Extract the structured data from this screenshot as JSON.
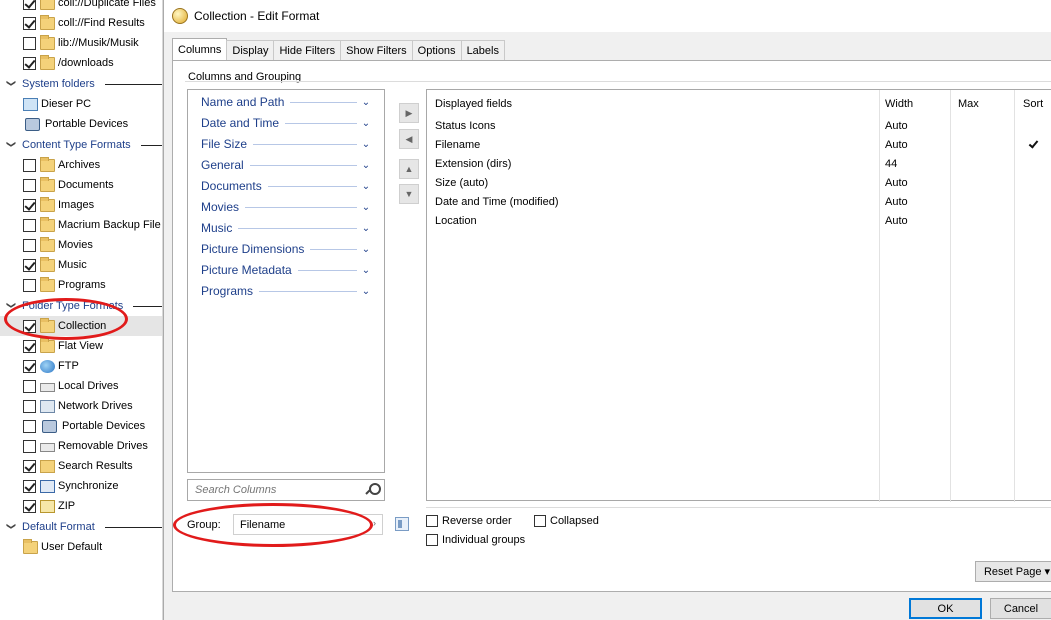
{
  "tree": {
    "top_items": [
      {
        "label": "coll://Duplicate Files",
        "checked": true,
        "icon": "folder-icon"
      },
      {
        "label": "coll://Find Results",
        "checked": true,
        "icon": "folder-icon"
      },
      {
        "label": "lib://Musik/Musik",
        "checked": false,
        "icon": "folder-icon"
      },
      {
        "label": "/downloads",
        "checked": true,
        "icon": "folder-info-icon"
      }
    ],
    "system_folders": {
      "header": "System folders",
      "items": [
        {
          "label": "Dieser PC",
          "icon": "computer-icon"
        },
        {
          "label": "Portable Devices",
          "icon": "portable-device-icon"
        }
      ]
    },
    "content_types": {
      "header": "Content Type Formats",
      "items": [
        {
          "label": "Archives",
          "checked": false,
          "icon": "folder-icon"
        },
        {
          "label": "Documents",
          "checked": false,
          "icon": "folder-icon"
        },
        {
          "label": "Images",
          "checked": true,
          "icon": "folder-icon"
        },
        {
          "label": "Macrium Backup File",
          "checked": false,
          "icon": "folder-icon"
        },
        {
          "label": "Movies",
          "checked": false,
          "icon": "folder-icon"
        },
        {
          "label": "Music",
          "checked": true,
          "icon": "folder-icon"
        },
        {
          "label": "Programs",
          "checked": false,
          "icon": "folder-icon"
        }
      ]
    },
    "folder_types": {
      "header": "Folder Type Formats",
      "items": [
        {
          "label": "Collection",
          "checked": true,
          "icon": "folder-icon",
          "selected": true
        },
        {
          "label": "Flat View",
          "checked": true,
          "icon": "flat-view-icon"
        },
        {
          "label": "FTP",
          "checked": true,
          "icon": "ftp-globe-icon"
        },
        {
          "label": "Local Drives",
          "checked": false,
          "icon": "local-drive-icon"
        },
        {
          "label": "Network Drives",
          "checked": false,
          "icon": "network-drive-icon"
        },
        {
          "label": "Portable Devices",
          "checked": false,
          "icon": "portable-device-icon"
        },
        {
          "label": "Removable Drives",
          "checked": false,
          "icon": "removable-drive-icon"
        },
        {
          "label": "Search Results",
          "checked": true,
          "icon": "search-results-icon"
        },
        {
          "label": "Synchronize",
          "checked": true,
          "icon": "synchronize-icon"
        },
        {
          "label": "ZIP",
          "checked": true,
          "icon": "zip-icon"
        }
      ]
    },
    "default_format": {
      "header": "Default Format",
      "items": [
        {
          "label": "User Default",
          "icon": "folder-icon"
        }
      ]
    }
  },
  "dialog": {
    "title": "Collection - Edit Format",
    "tabs": [
      "Columns",
      "Display",
      "Hide Filters",
      "Show Filters",
      "Options",
      "Labels"
    ],
    "active_tab": "Columns",
    "group_title": "Columns and Grouping",
    "categories": [
      "Name and Path",
      "Date and Time",
      "File Size",
      "General",
      "Documents",
      "Movies",
      "Music",
      "Picture Dimensions",
      "Picture Metadata",
      "Programs"
    ],
    "columns": {
      "headers": [
        "Displayed fields",
        "Width",
        "Max",
        "Sort"
      ],
      "rows": [
        {
          "field": "Status Icons",
          "width": "Auto",
          "max": "",
          "sort": false
        },
        {
          "field": "Filename",
          "width": "Auto",
          "max": "",
          "sort": true
        },
        {
          "field": "Extension (dirs)",
          "width": "44",
          "max": "",
          "sort": false
        },
        {
          "field": "Size (auto)",
          "width": "Auto",
          "max": "",
          "sort": false
        },
        {
          "field": "Date and Time (modified)",
          "width": "Auto",
          "max": "",
          "sort": false
        },
        {
          "field": "Location",
          "width": "Auto",
          "max": "",
          "sort": false
        }
      ]
    },
    "search_placeholder": "Search Columns",
    "group": {
      "label": "Group:",
      "value": "Filename"
    },
    "options": {
      "reverse_order": {
        "label": "Reverse order",
        "checked": false
      },
      "collapsed": {
        "label": "Collapsed",
        "checked": false
      },
      "individual_groups": {
        "label": "Individual groups",
        "checked": false
      }
    },
    "reset_label": "Reset Page ▾",
    "ok_label": "OK",
    "cancel_label": "Cancel"
  },
  "annotation_color": "#e11b1b"
}
